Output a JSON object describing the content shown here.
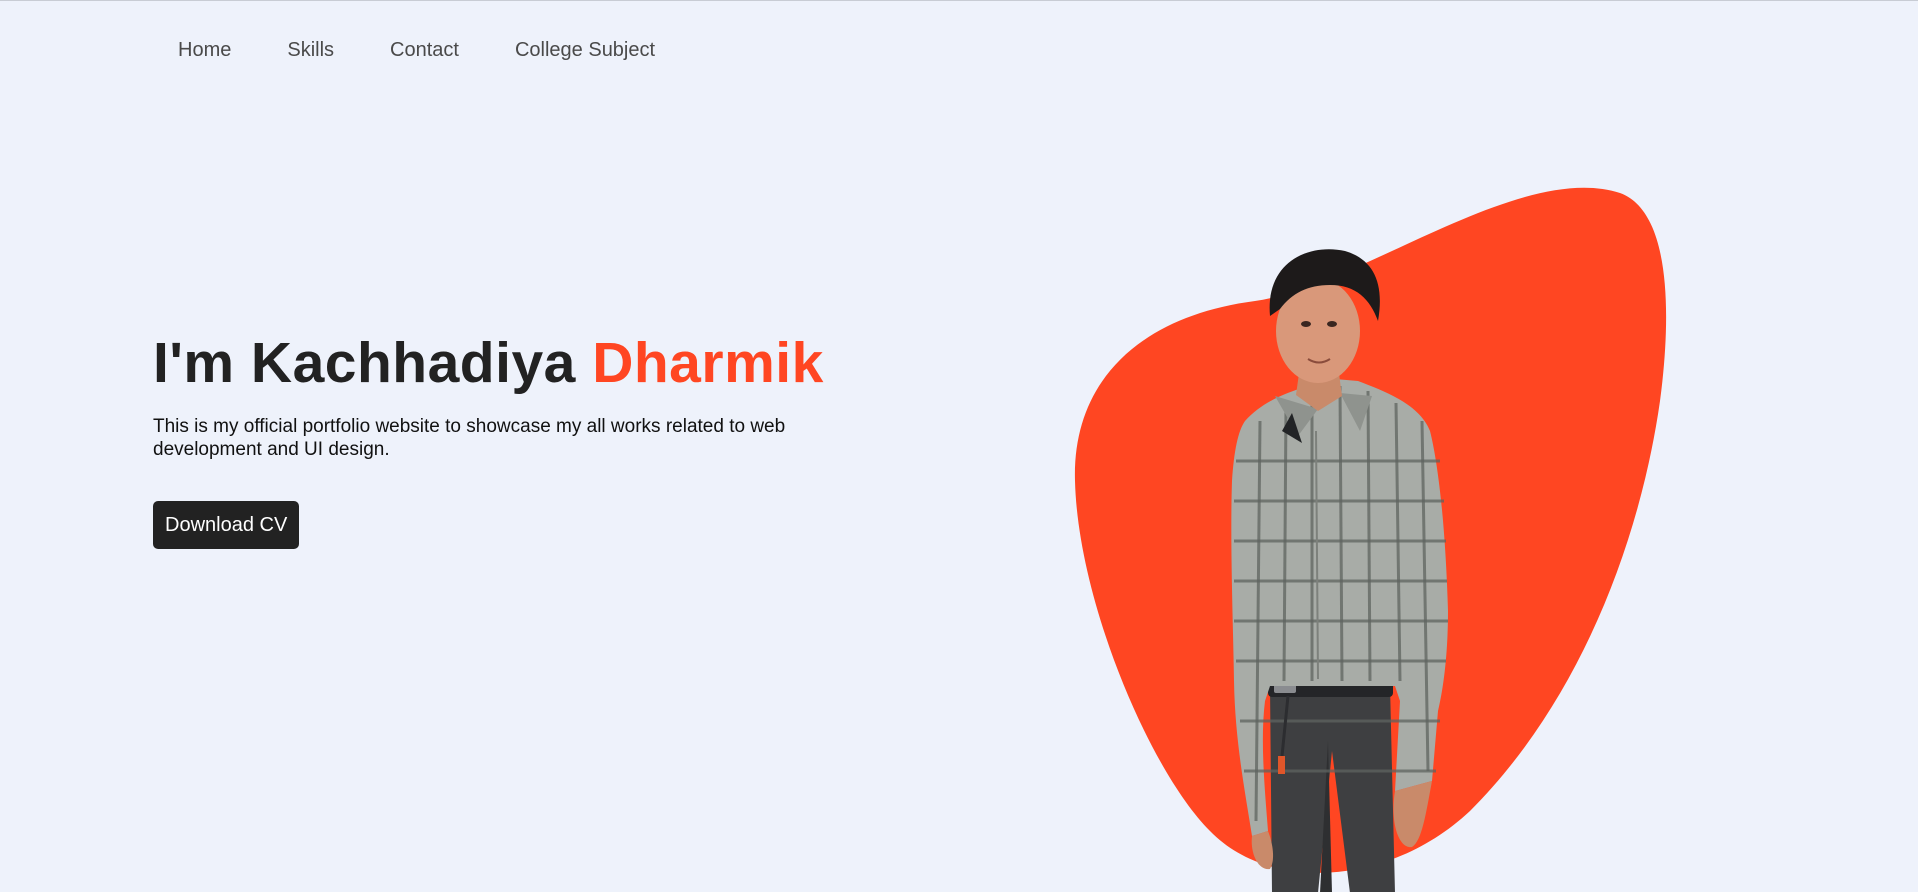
{
  "nav": {
    "items": [
      {
        "label": "Home"
      },
      {
        "label": "Skills"
      },
      {
        "label": "Contact"
      },
      {
        "label": "College Subject"
      }
    ]
  },
  "hero": {
    "title_prefix": "I'm Kachhadiya ",
    "title_highlight": "Dharmik",
    "description": "This is my official portfolio website to showcase my all works related to web development and UI design.",
    "cta_label": "Download CV"
  },
  "colors": {
    "background": "#eef2fb",
    "accent": "#ff4622",
    "text": "#222222",
    "button_bg": "#222222"
  }
}
